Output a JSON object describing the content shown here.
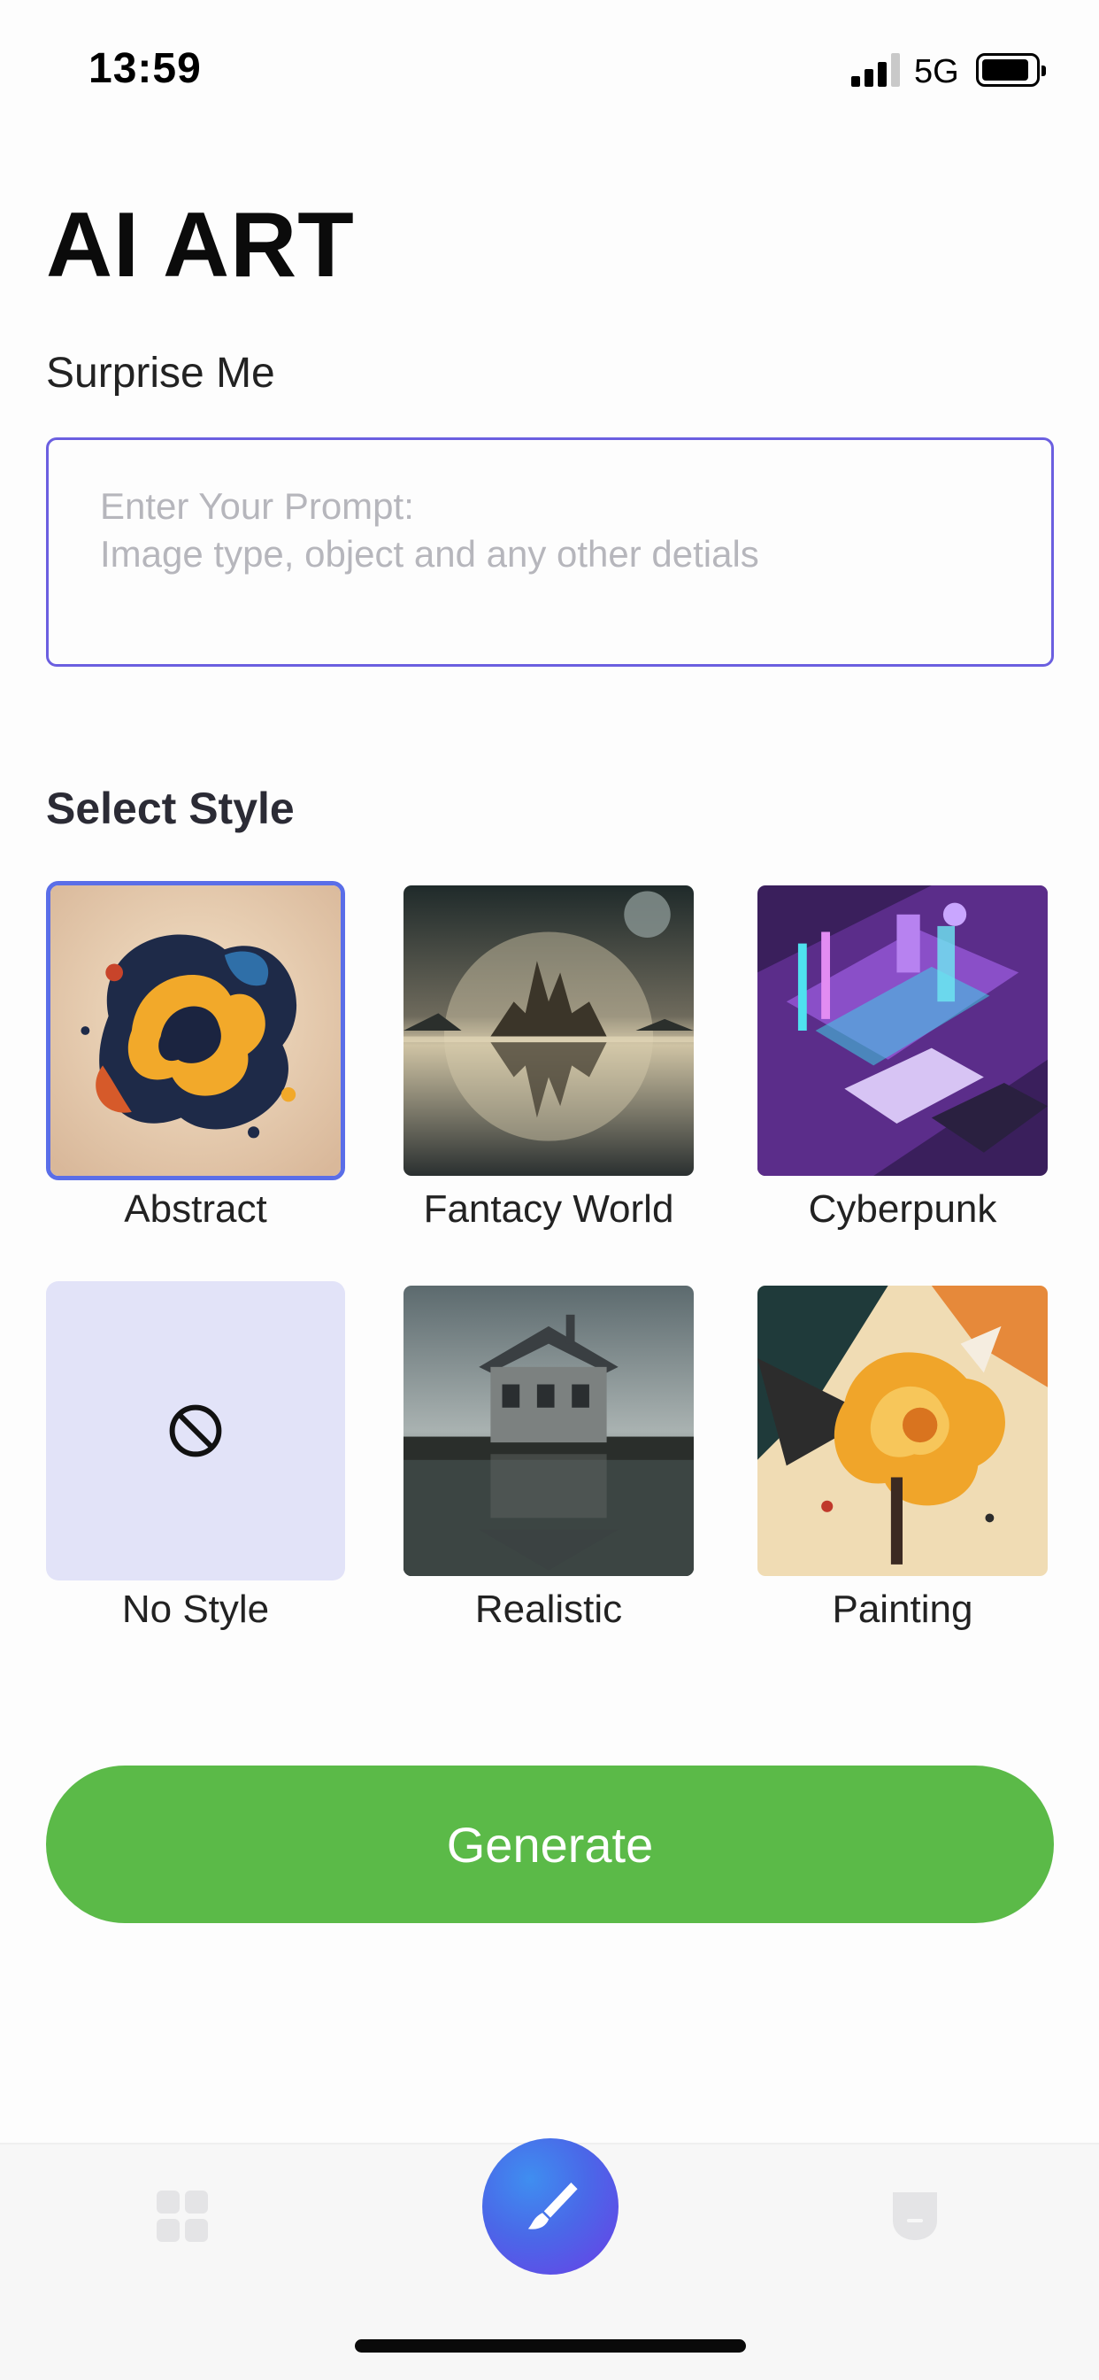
{
  "status_bar": {
    "time": "13:59",
    "network": "5G",
    "signal_bars_active": 3,
    "signal_bars_total": 4,
    "battery_icon": "battery-full-icon"
  },
  "header": {
    "title": "AI ART",
    "surprise_label": "Surprise Me"
  },
  "prompt": {
    "placeholder": "Enter Your Prompt:\nImage type, object and any other detials",
    "value": "",
    "border_color": "#6b5fe0"
  },
  "styles": {
    "title": "Select Style",
    "selected": "Abstract",
    "selected_border_color": "#5a6ee8",
    "items": [
      {
        "label": "Abstract"
      },
      {
        "label": "Fantacy World"
      },
      {
        "label": "Cyberpunk"
      },
      {
        "label": "No Style",
        "icon": "no-symbol-icon"
      },
      {
        "label": "Realistic"
      },
      {
        "label": "Painting"
      }
    ]
  },
  "actions": {
    "generate_label": "Generate",
    "generate_color": "#5bba48"
  },
  "tab_bar": {
    "items": [
      {
        "icon": "grid-icon",
        "active": false
      },
      {
        "icon": "paintbrush-icon",
        "active": true
      },
      {
        "icon": "profile-icon",
        "active": false
      }
    ]
  }
}
